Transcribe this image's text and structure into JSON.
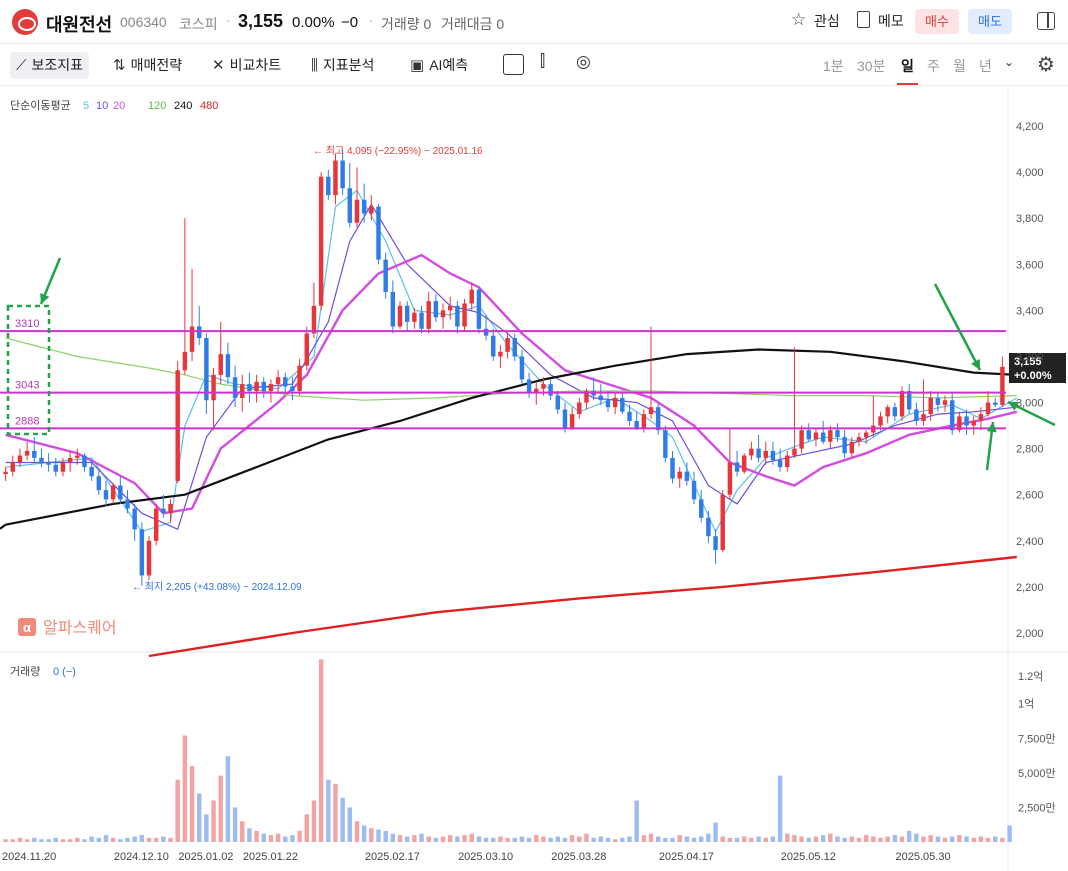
{
  "header": {
    "name": "대원전선",
    "code": "006340",
    "market": "코스피",
    "separator": "·",
    "price": "3,155",
    "change_pct": "0.00%",
    "change_abs": "−0",
    "volume": "거래량 0",
    "amount": "거래대금 0",
    "watch_label": "관심",
    "memo_label": "메모",
    "buy_label": "매수",
    "sell_label": "매도"
  },
  "toolbar": {
    "indicators": "보조지표",
    "strategy": "매매전략",
    "compare": "비교차트",
    "analysis": "지표분석",
    "ai": "AI예측",
    "periods": [
      "1분",
      "30분",
      "일",
      "주",
      "월",
      "년"
    ],
    "active_period": "일"
  },
  "chart_data": {
    "type": "candlestick",
    "title": "",
    "ma_legend": {
      "label": "단순이동평균",
      "periods": [
        "5",
        "10",
        "20",
        "120",
        "240",
        "480"
      ]
    },
    "price_axis": {
      "ticks": [
        "4,200",
        "4,000",
        "3,800",
        "3,600",
        "3,400",
        "3,200",
        "3,000",
        "2,800",
        "2,600",
        "2,400",
        "2,200",
        "2,000"
      ],
      "ylim": [
        1900,
        4300
      ]
    },
    "last_price_tag": {
      "price": "3,155",
      "change": "+0.00%"
    },
    "max_annotation": "최고 4,095 (−22.95%) − 2025.01.16",
    "min_annotation": "최지 2,205 (+43.08%) − 2024.12.09",
    "horizontal_lines": [
      {
        "label": "3310",
        "value": 3310
      },
      {
        "label": "3043",
        "value": 3043
      },
      {
        "label": "2888",
        "value": 2888
      }
    ],
    "date_labels": [
      "2024.11.20",
      "2024.12.10",
      "2025.01.02",
      "2025.01.22",
      "2025.02.17",
      "2025.03.10",
      "2025.03.28",
      "2025.04.17",
      "2025.05.12",
      "2025.05.30"
    ],
    "watermark": "알파스퀘어",
    "volume_panel": {
      "label": "거래량",
      "value": "0 (−)",
      "ticks": [
        "1.2억",
        "1억",
        "7,500만",
        "5,000만",
        "2,500만"
      ],
      "ylim": [
        0,
        130000000
      ]
    },
    "candles": [
      [
        2690,
        2720,
        2660,
        2700
      ],
      [
        2700,
        2770,
        2680,
        2740
      ],
      [
        2740,
        2800,
        2720,
        2770
      ],
      [
        2770,
        2830,
        2750,
        2790
      ],
      [
        2790,
        2850,
        2740,
        2760
      ],
      [
        2760,
        2800,
        2720,
        2740
      ],
      [
        2740,
        2780,
        2700,
        2730
      ],
      [
        2730,
        2760,
        2680,
        2700
      ],
      [
        2700,
        2760,
        2680,
        2740
      ],
      [
        2740,
        2790,
        2700,
        2760
      ],
      [
        2760,
        2800,
        2730,
        2770
      ],
      [
        2770,
        2780,
        2700,
        2720
      ],
      [
        2720,
        2750,
        2660,
        2680
      ],
      [
        2680,
        2710,
        2600,
        2620
      ],
      [
        2620,
        2660,
        2550,
        2580
      ],
      [
        2580,
        2650,
        2560,
        2640
      ],
      [
        2640,
        2680,
        2560,
        2580
      ],
      [
        2580,
        2620,
        2520,
        2540
      ],
      [
        2540,
        2560,
        2400,
        2450
      ],
      [
        2450,
        2480,
        2205,
        2250
      ],
      [
        2250,
        2420,
        2230,
        2400
      ],
      [
        2400,
        2560,
        2380,
        2540
      ],
      [
        2540,
        2600,
        2500,
        2520
      ],
      [
        2520,
        2580,
        2480,
        2560
      ],
      [
        2660,
        3180,
        2650,
        3140
      ],
      [
        3140,
        3800,
        3120,
        3220
      ],
      [
        3220,
        3580,
        3180,
        3330
      ],
      [
        3330,
        3420,
        3250,
        3280
      ],
      [
        3280,
        3300,
        2950,
        3010
      ],
      [
        3010,
        3150,
        2880,
        3120
      ],
      [
        3120,
        3350,
        3080,
        3210
      ],
      [
        3210,
        3260,
        3080,
        3110
      ],
      [
        3110,
        3160,
        2980,
        3020
      ],
      [
        3020,
        3120,
        2960,
        3080
      ],
      [
        3080,
        3130,
        3000,
        3050
      ],
      [
        3050,
        3120,
        3000,
        3090
      ],
      [
        3090,
        3110,
        3020,
        3050
      ],
      [
        3050,
        3100,
        3000,
        3080
      ],
      [
        3080,
        3140,
        3040,
        3110
      ],
      [
        3110,
        3130,
        3040,
        3070
      ],
      [
        3070,
        3110,
        3010,
        3050
      ],
      [
        3050,
        3190,
        3030,
        3160
      ],
      [
        3160,
        3330,
        3140,
        3300
      ],
      [
        3300,
        3520,
        3280,
        3420
      ],
      [
        3420,
        4000,
        3400,
        3980
      ],
      [
        3980,
        4010,
        3880,
        3900
      ],
      [
        3900,
        4080,
        3860,
        4050
      ],
      [
        4050,
        4095,
        3900,
        3930
      ],
      [
        3930,
        4040,
        3760,
        3780
      ],
      [
        3780,
        4020,
        3760,
        3880
      ],
      [
        3880,
        3950,
        3780,
        3820
      ],
      [
        3820,
        3900,
        3790,
        3850
      ],
      [
        3850,
        3860,
        3600,
        3620
      ],
      [
        3620,
        3650,
        3450,
        3480
      ],
      [
        3480,
        3530,
        3300,
        3330
      ],
      [
        3330,
        3440,
        3320,
        3420
      ],
      [
        3420,
        3440,
        3310,
        3350
      ],
      [
        3350,
        3410,
        3320,
        3390
      ],
      [
        3390,
        3420,
        3300,
        3320
      ],
      [
        3320,
        3480,
        3300,
        3440
      ],
      [
        3440,
        3470,
        3350,
        3370
      ],
      [
        3370,
        3430,
        3320,
        3400
      ],
      [
        3400,
        3460,
        3360,
        3420
      ],
      [
        3420,
        3440,
        3300,
        3330
      ],
      [
        3330,
        3450,
        3310,
        3430
      ],
      [
        3430,
        3520,
        3400,
        3490
      ],
      [
        3490,
        3500,
        3300,
        3320
      ],
      [
        3320,
        3380,
        3270,
        3290
      ],
      [
        3290,
        3320,
        3180,
        3200
      ],
      [
        3200,
        3250,
        3150,
        3220
      ],
      [
        3220,
        3300,
        3190,
        3280
      ],
      [
        3280,
        3300,
        3180,
        3200
      ],
      [
        3200,
        3230,
        3080,
        3100
      ],
      [
        3100,
        3130,
        3020,
        3040
      ],
      [
        3040,
        3090,
        2990,
        3060
      ],
      [
        3060,
        3110,
        3030,
        3080
      ],
      [
        3080,
        3100,
        3010,
        3030
      ],
      [
        3030,
        3050,
        2950,
        2970
      ],
      [
        2970,
        3000,
        2870,
        2890
      ],
      [
        2890,
        2980,
        2880,
        2950
      ],
      [
        2950,
        3020,
        2930,
        3000
      ],
      [
        3000,
        3060,
        2970,
        3050
      ],
      [
        3050,
        3110,
        3010,
        3030
      ],
      [
        3030,
        3080,
        2990,
        3010
      ],
      [
        3010,
        3050,
        2960,
        2980
      ],
      [
        2980,
        3040,
        2950,
        3020
      ],
      [
        3020,
        3040,
        2950,
        2960
      ],
      [
        2960,
        2990,
        2900,
        2920
      ],
      [
        2920,
        2960,
        2880,
        2890
      ],
      [
        2890,
        2970,
        2870,
        2950
      ],
      [
        2950,
        3330,
        2930,
        2980
      ],
      [
        2980,
        3000,
        2860,
        2880
      ],
      [
        2880,
        2900,
        2740,
        2760
      ],
      [
        2760,
        2790,
        2650,
        2670
      ],
      [
        2670,
        2720,
        2630,
        2700
      ],
      [
        2700,
        2740,
        2640,
        2660
      ],
      [
        2660,
        2700,
        2560,
        2580
      ],
      [
        2580,
        2620,
        2480,
        2500
      ],
      [
        2500,
        2530,
        2390,
        2420
      ],
      [
        2420,
        2450,
        2300,
        2360
      ],
      [
        2360,
        2620,
        2350,
        2600
      ],
      [
        2600,
        2890,
        2580,
        2740
      ],
      [
        2740,
        2790,
        2680,
        2700
      ],
      [
        2700,
        2780,
        2690,
        2770
      ],
      [
        2770,
        2830,
        2750,
        2800
      ],
      [
        2800,
        2860,
        2740,
        2760
      ],
      [
        2760,
        2830,
        2730,
        2790
      ],
      [
        2790,
        2830,
        2730,
        2750
      ],
      [
        2750,
        2800,
        2700,
        2720
      ],
      [
        2720,
        2790,
        2700,
        2770
      ],
      [
        2770,
        3240,
        2760,
        2800
      ],
      [
        2800,
        2900,
        2780,
        2880
      ],
      [
        2880,
        2910,
        2830,
        2840
      ],
      [
        2840,
        2890,
        2810,
        2870
      ],
      [
        2870,
        2920,
        2820,
        2830
      ],
      [
        2830,
        2900,
        2800,
        2880
      ],
      [
        2880,
        2910,
        2830,
        2850
      ],
      [
        2850,
        2880,
        2760,
        2780
      ],
      [
        2780,
        2850,
        2760,
        2830
      ],
      [
        2830,
        2870,
        2810,
        2850
      ],
      [
        2850,
        2880,
        2820,
        2870
      ],
      [
        2870,
        3030,
        2850,
        2900
      ],
      [
        2900,
        2960,
        2880,
        2940
      ],
      [
        2940,
        2990,
        2910,
        2980
      ],
      [
        2980,
        3000,
        2920,
        2940
      ],
      [
        2940,
        3070,
        2920,
        3050
      ],
      [
        3050,
        3080,
        2950,
        2970
      ],
      [
        2970,
        3000,
        2900,
        2920
      ],
      [
        2920,
        3100,
        2900,
        2950
      ],
      [
        2950,
        3050,
        2920,
        3020
      ],
      [
        3020,
        3040,
        2960,
        2990
      ],
      [
        2990,
        3030,
        2960,
        3010
      ],
      [
        3010,
        3040,
        2860,
        2880
      ],
      [
        2880,
        2960,
        2870,
        2940
      ],
      [
        2940,
        2970,
        2860,
        2900
      ],
      [
        2900,
        2940,
        2860,
        2920
      ],
      [
        2920,
        2980,
        2880,
        2950
      ],
      [
        2950,
        3050,
        2940,
        3000
      ],
      [
        3000,
        3020,
        2980,
        2990
      ],
      [
        2990,
        3200,
        2980,
        3155
      ]
    ],
    "volumes_m": [
      2,
      2,
      3,
      2,
      3,
      2,
      2,
      3,
      2,
      2,
      3,
      2,
      4,
      3,
      5,
      3,
      2,
      3,
      4,
      5,
      3,
      3,
      4,
      3,
      45,
      77,
      55,
      35,
      20,
      30,
      48,
      62,
      25,
      15,
      10,
      8,
      6,
      5,
      6,
      4,
      5,
      8,
      20,
      30,
      132,
      45,
      42,
      32,
      25,
      15,
      12,
      10,
      9,
      8,
      6,
      5,
      4,
      5,
      6,
      4,
      3,
      4,
      5,
      4,
      5,
      6,
      4,
      3,
      3,
      4,
      3,
      3,
      4,
      3,
      5,
      4,
      3,
      4,
      3,
      5,
      4,
      6,
      3,
      4,
      3,
      2,
      3,
      4,
      30,
      5,
      6,
      4,
      3,
      3,
      5,
      4,
      3,
      4,
      6,
      14,
      4,
      3,
      3,
      4,
      3,
      4,
      3,
      4,
      48,
      6,
      5,
      4,
      3,
      4,
      5,
      6,
      4,
      3,
      4,
      3,
      5,
      4,
      3,
      4,
      5,
      4,
      8,
      6,
      4,
      5,
      4,
      3,
      4,
      5,
      4,
      3,
      4,
      3,
      4,
      3,
      12
    ],
    "ma_paths": {
      "ma5": [
        [
          0,
          2720
        ],
        [
          12,
          2760
        ],
        [
          19,
          2440
        ],
        [
          23,
          2480
        ],
        [
          25,
          2900
        ],
        [
          28,
          3120
        ],
        [
          32,
          3080
        ],
        [
          38,
          3060
        ],
        [
          43,
          3200
        ],
        [
          46,
          3850
        ],
        [
          49,
          3920
        ],
        [
          53,
          3700
        ],
        [
          57,
          3400
        ],
        [
          62,
          3380
        ],
        [
          66,
          3420
        ],
        [
          70,
          3250
        ],
        [
          75,
          3080
        ],
        [
          80,
          2960
        ],
        [
          85,
          3020
        ],
        [
          90,
          2920
        ],
        [
          93,
          2850
        ],
        [
          99,
          2440
        ],
        [
          102,
          2620
        ],
        [
          106,
          2760
        ],
        [
          111,
          2820
        ],
        [
          114,
          2850
        ],
        [
          120,
          2830
        ],
        [
          126,
          2950
        ],
        [
          132,
          2990
        ],
        [
          136,
          2930
        ],
        [
          141,
          3020
        ]
      ],
      "ma10": [
        [
          0,
          2740
        ],
        [
          12,
          2740
        ],
        [
          19,
          2520
        ],
        [
          24,
          2450
        ],
        [
          28,
          2850
        ],
        [
          33,
          3060
        ],
        [
          40,
          3080
        ],
        [
          45,
          3350
        ],
        [
          48,
          3700
        ],
        [
          51,
          3860
        ],
        [
          56,
          3600
        ],
        [
          62,
          3420
        ],
        [
          66,
          3390
        ],
        [
          70,
          3300
        ],
        [
          76,
          3120
        ],
        [
          82,
          3020
        ],
        [
          88,
          3000
        ],
        [
          93,
          2920
        ],
        [
          98,
          2640
        ],
        [
          102,
          2560
        ],
        [
          106,
          2740
        ],
        [
          112,
          2780
        ],
        [
          118,
          2820
        ],
        [
          124,
          2900
        ],
        [
          130,
          2950
        ],
        [
          135,
          2960
        ],
        [
          141,
          2980
        ]
      ],
      "ma20": [
        [
          0,
          2860
        ],
        [
          10,
          2780
        ],
        [
          18,
          2650
        ],
        [
          22,
          2520
        ],
        [
          26,
          2540
        ],
        [
          30,
          2800
        ],
        [
          38,
          3000
        ],
        [
          42,
          3120
        ],
        [
          47,
          3400
        ],
        [
          52,
          3560
        ],
        [
          58,
          3640
        ],
        [
          62,
          3560
        ],
        [
          66,
          3500
        ],
        [
          72,
          3300
        ],
        [
          78,
          3140
        ],
        [
          84,
          3080
        ],
        [
          90,
          3020
        ],
        [
          96,
          2900
        ],
        [
          101,
          2740
        ],
        [
          106,
          2680
        ],
        [
          110,
          2640
        ],
        [
          114,
          2720
        ],
        [
          120,
          2780
        ],
        [
          126,
          2860
        ],
        [
          132,
          2900
        ],
        [
          137,
          2930
        ],
        [
          141,
          2960
        ]
      ],
      "ma120": [
        [
          0,
          3280
        ],
        [
          10,
          3200
        ],
        [
          20,
          3150
        ],
        [
          25,
          3120
        ],
        [
          30,
          3080
        ],
        [
          40,
          3030
        ],
        [
          50,
          3010
        ],
        [
          60,
          3020
        ],
        [
          70,
          3040
        ],
        [
          80,
          3050
        ],
        [
          90,
          3050
        ],
        [
          100,
          3040
        ],
        [
          110,
          3030
        ],
        [
          120,
          3030
        ],
        [
          130,
          3020
        ],
        [
          141,
          3030
        ]
      ],
      "ma240": [
        [
          0,
          2470
        ],
        [
          15,
          2560
        ],
        [
          25,
          2600
        ],
        [
          35,
          2720
        ],
        [
          45,
          2840
        ],
        [
          55,
          2920
        ],
        [
          65,
          3020
        ],
        [
          75,
          3100
        ],
        [
          85,
          3160
        ],
        [
          95,
          3210
        ],
        [
          105,
          3230
        ],
        [
          115,
          3220
        ],
        [
          125,
          3180
        ],
        [
          135,
          3130
        ],
        [
          141,
          3120
        ]
      ],
      "ma480": [
        [
          20,
          1900
        ],
        [
          40,
          2000
        ],
        [
          60,
          2090
        ],
        [
          80,
          2150
        ],
        [
          100,
          2200
        ],
        [
          120,
          2260
        ],
        [
          141,
          2330
        ]
      ]
    }
  }
}
